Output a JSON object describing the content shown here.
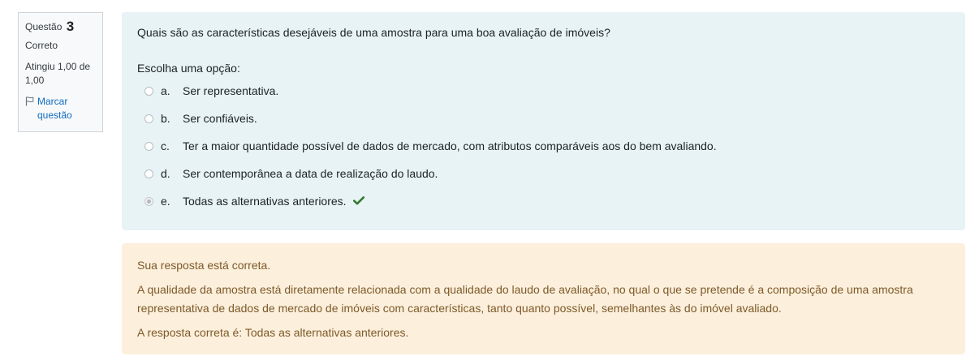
{
  "info": {
    "question_label": "Questão",
    "question_number": "3",
    "state": "Correto",
    "grade": "Atingiu 1,00 de 1,00",
    "flag_label": "Marcar questão"
  },
  "question": {
    "text": "Quais são as características desejáveis de uma amostra para uma boa avaliação de imóveis?",
    "prompt": "Escolha uma opção:",
    "options": [
      {
        "letter": "a.",
        "text": "Ser representativa.",
        "selected": false
      },
      {
        "letter": "b.",
        "text": "Ser confiáveis.",
        "selected": false
      },
      {
        "letter": "c.",
        "text": "Ter a maior quantidade possível de dados de mercado, com atributos comparáveis aos do bem avaliando.",
        "selected": false
      },
      {
        "letter": "d.",
        "text": "Ser contemporânea a data de realização do laudo.",
        "selected": false
      },
      {
        "letter": "e.",
        "text": "Todas as alternativas anteriores.",
        "selected": true
      }
    ]
  },
  "feedback": {
    "specific": "Sua resposta está correta.",
    "general": "A qualidade da amostra está diretamente relacionada com a qualidade do laudo de avaliação, no qual o que se pretende é a composição de uma amostra representativa de dados de mercado de imóveis com características, tanto quanto possível, semelhantes às do imóvel avaliado.",
    "right_answer": "A resposta correta é: Todas as alternativas anteriores."
  },
  "colors": {
    "formulation_bg": "#e7f3f5",
    "feedback_bg": "#fcefdc",
    "feedback_text": "#7d5a29",
    "correct_check": "#357a32",
    "link": "#0f6cbf"
  },
  "icons": {
    "flag": "flag-outline-icon",
    "correct": "check-icon"
  }
}
